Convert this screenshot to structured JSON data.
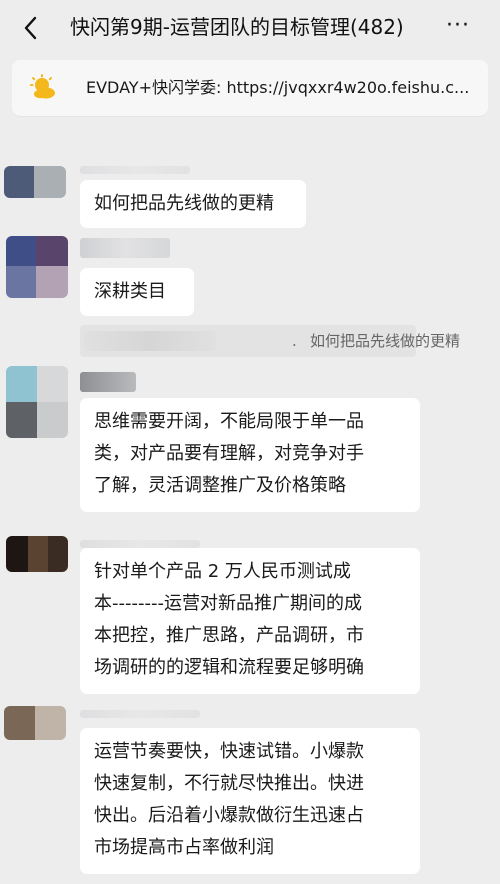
{
  "header": {
    "title": "快闪第9期-运营团队的目标管理(482)",
    "back_icon": "chevron-left-icon",
    "more_label": "···"
  },
  "pinned": {
    "icon": "sun-cloud-icon",
    "text": "EVDAY+快闪学委: https://jvqxxr4w20o.feishu.c..."
  },
  "messages": [
    {
      "lines": [
        "如何把品先线做的更精"
      ]
    },
    {
      "lines": [
        "深耕类目"
      ],
      "quote": {
        "separator": ".",
        "text": "如何把品先线做的更精"
      }
    },
    {
      "lines": [
        "思维需要开阔，不能局限于单一品",
        "类，对产品要有理解，对竞争对手",
        "了解，灵活调整推广及价格策略"
      ]
    },
    {
      "lines": [
        "针对单个产品 2 万人民币测试成",
        "本--------运营对新品推广期间的成",
        "本把控，推广思路，产品调研，市",
        "场调研的的逻辑和流程要足够明确"
      ]
    },
    {
      "lines": [
        "运营节奏要快，快速试错。小爆款",
        "快速复制，不行就尽快推出。快进",
        "快出。后沿着小爆款做衍生迅速占",
        "市场提高市占率做利润"
      ]
    }
  ],
  "colors": {
    "background": "#ededed",
    "bubble": "#ffffff",
    "pinned_bg": "#f7f7f7",
    "sun": "#f5b81c"
  }
}
